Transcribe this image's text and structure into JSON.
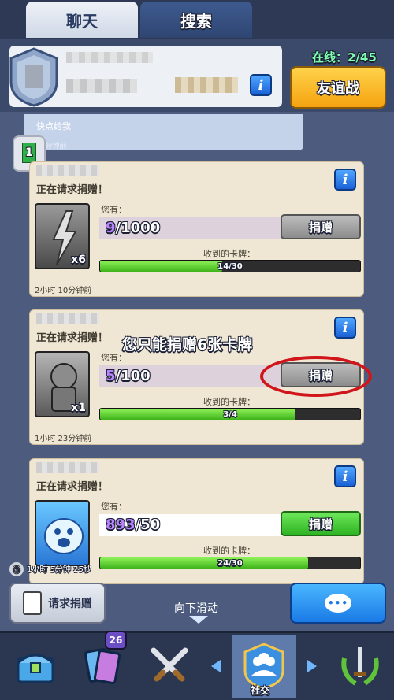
{
  "tabs": [
    {
      "label": "聊天",
      "active": true
    },
    {
      "label": "搜索",
      "active": false
    }
  ],
  "clan": {
    "online_text": "在线：2/45",
    "friendly_battle_label": "友谊战",
    "info_icon": "info-icon"
  },
  "chat_message": {
    "text": "快点给我",
    "time": "38分钟前",
    "level": "1"
  },
  "requests": [
    {
      "title": "正在请求捐赠！",
      "you_have_label": "您有：",
      "have": "9",
      "have_max": "/1000",
      "donate_label": "捐赠",
      "donate_enabled": false,
      "received_label": "收到的卡牌：",
      "progress_text": "14/30",
      "progress": 0.47,
      "card_count": "x6",
      "time": "2小时 10分钟前"
    },
    {
      "title": "正在请求捐赠！",
      "you_have_label": "您有：",
      "have": "5",
      "have_max": "/100",
      "donate_label": "捐赠",
      "donate_enabled": false,
      "received_label": "收到的卡牌：",
      "progress_text": "3/4",
      "progress": 0.75,
      "card_count": "x1",
      "time": "1小时 23分钟前"
    },
    {
      "title": "正在请求捐赠！",
      "you_have_label": "您有：",
      "have": "893",
      "have_max": "/50",
      "donate_label": "捐赠",
      "donate_enabled": true,
      "received_label": "收到的卡牌：",
      "progress_text": "24/30",
      "progress": 0.8,
      "card_count": "",
      "time": "1小时 5分钟 25秒"
    }
  ],
  "annotation": {
    "text": "您只能捐赠6张卡牌",
    "ring_color": "#d0161b"
  },
  "bottom": {
    "request_donation_label": "请求捐赠",
    "scroll_label": "向下滑动",
    "chat_icon": "speech-bubble-icon"
  },
  "nav": {
    "active_label": "社交",
    "deck_badge": "26",
    "items": [
      "chest-icon",
      "cards-icon",
      "battle-icon",
      "social-icon",
      "tournament-icon"
    ]
  },
  "colors": {
    "accent_blue": "#1a7ae6",
    "donate_green": "#2fb324",
    "friendly_orange": "#f5a310",
    "online_green": "#7dffb0"
  }
}
